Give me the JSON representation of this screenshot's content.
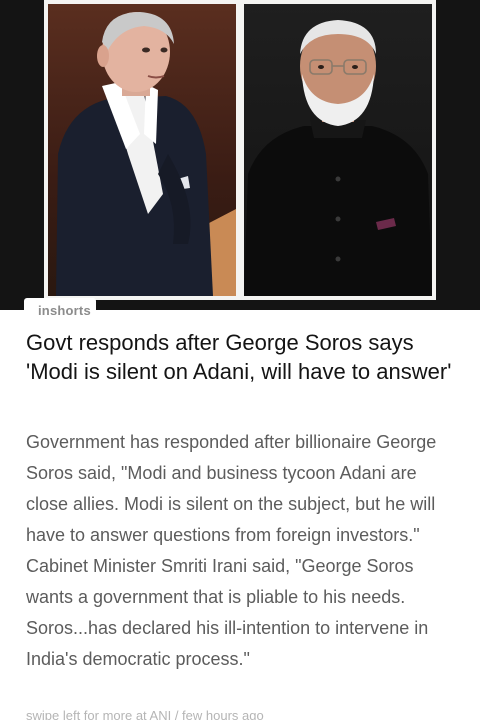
{
  "article": {
    "source": "inshorts",
    "headline": "Govt responds after George Soros says 'Modi is silent on Adani, will have to answer'",
    "summary": "Government has responded after billionaire George Soros said, \"Modi and business tycoon Adani are close allies. Modi is silent on the subject, but he will have to answer questions from foreign investors.\" Cabinet Minister Smriti Irani said, \"George Soros wants a government that is pliable to his needs. Soros...has declared his ill-intention to intervene in India's democratic process.\"",
    "footer": "swipe left for more at ANI / few hours ago"
  },
  "colors": {
    "hero_background": "#141414",
    "headline": "#141414",
    "summary": "#5c5c5c",
    "source": "#8c8c8c",
    "footer": "#b5b5b5"
  }
}
